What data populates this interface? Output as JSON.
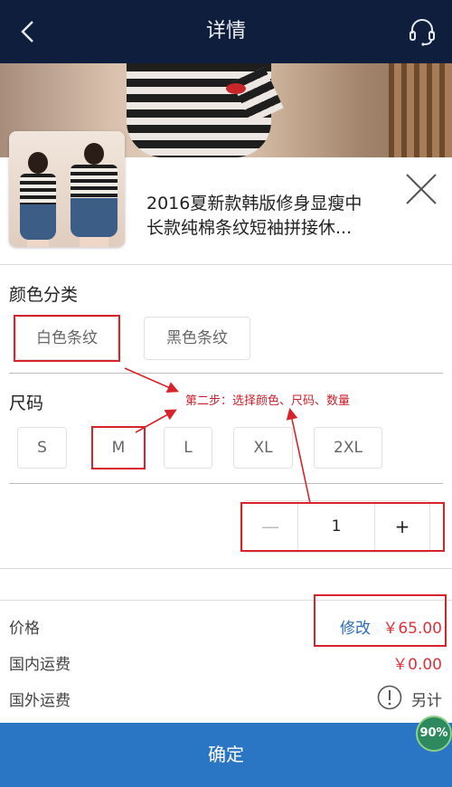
{
  "navbar": {
    "title": "详情"
  },
  "product": {
    "title_line1": "2016夏新款韩版修身显瘦中",
    "title_line2": "长款纯棉条纹短袖拼接休..."
  },
  "color_section": {
    "label": "颜色分类",
    "options": [
      "白色条纹",
      "黑色条纹"
    ],
    "selected": "白色条纹"
  },
  "size_section": {
    "label": "尺码",
    "options": [
      "S",
      "M",
      "L",
      "XL",
      "2XL"
    ],
    "selected": "M"
  },
  "quantity": {
    "minus": "—",
    "value": "1",
    "plus": "+"
  },
  "pricing": {
    "price_label": "价格",
    "edit_label": "修改",
    "price_value": "￥65.00",
    "domestic_label": "国内运费",
    "domestic_value": "￥0.00",
    "intl_label": "国外运费",
    "intl_value": "另计"
  },
  "confirm_label": "确定",
  "progress_badge": "90%",
  "annotation": {
    "text": "第二步：选择颜色、尺码、数量"
  },
  "colors": {
    "navbar": "#0f1e3c",
    "confirm": "#2a75c4",
    "price": "#e0313a",
    "annotation": "#d8232a"
  }
}
